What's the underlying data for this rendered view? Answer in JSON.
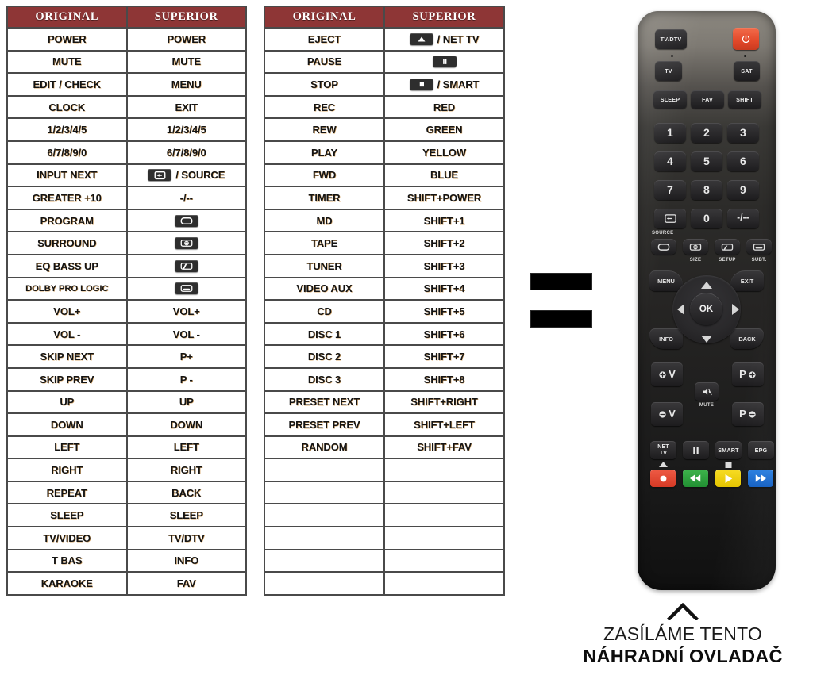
{
  "tables": [
    {
      "id": "table-left",
      "headers": [
        "ORIGINAL",
        "SUPERIOR"
      ],
      "rows": [
        {
          "original": "POWER",
          "superior": "POWER"
        },
        {
          "original": "MUTE",
          "superior": "MUTE"
        },
        {
          "original": "EDIT / CHECK",
          "superior": "MENU"
        },
        {
          "original": "CLOCK",
          "superior": "EXIT"
        },
        {
          "original": "1/2/3/4/5",
          "superior": "1/2/3/4/5"
        },
        {
          "original": "6/7/8/9/0",
          "superior": "6/7/8/9/0"
        },
        {
          "original": "INPUT NEXT",
          "superior": "/ SOURCE",
          "icon": "source-icon"
        },
        {
          "original": "GREATER +10",
          "superior": "-/--"
        },
        {
          "original": "PROGRAM",
          "superior": "",
          "icon": "aspect-ratio-icon"
        },
        {
          "original": "SURROUND",
          "superior": "",
          "icon": "size-icon"
        },
        {
          "original": "EQ BASS UP",
          "superior": "",
          "icon": "setup-icon"
        },
        {
          "original": "DOLBY PRO LOGIC",
          "superior": "",
          "icon": "subtitle-icon",
          "small": true
        },
        {
          "original": "VOL+",
          "superior": "VOL+"
        },
        {
          "original": "VOL -",
          "superior": "VOL -"
        },
        {
          "original": "SKIP NEXT",
          "superior": "P+"
        },
        {
          "original": "SKIP PREV",
          "superior": "P -"
        },
        {
          "original": "UP",
          "superior": "UP"
        },
        {
          "original": "DOWN",
          "superior": "DOWN"
        },
        {
          "original": "LEFT",
          "superior": "LEFT"
        },
        {
          "original": "RIGHT",
          "superior": "RIGHT"
        },
        {
          "original": "REPEAT",
          "superior": "BACK"
        },
        {
          "original": "SLEEP",
          "superior": "SLEEP"
        },
        {
          "original": "TV/VIDEO",
          "superior": "TV/DTV"
        },
        {
          "original": "T BAS",
          "superior": "INFO"
        },
        {
          "original": "KARAOKE",
          "superior": "FAV"
        }
      ]
    },
    {
      "id": "table-right",
      "headers": [
        "ORIGINAL",
        "SUPERIOR"
      ],
      "rows": [
        {
          "original": "EJECT",
          "superior": "/ NET TV",
          "icon": "eject-icon"
        },
        {
          "original": "PAUSE",
          "superior": "",
          "icon": "pause-icon"
        },
        {
          "original": "STOP",
          "superior": "/ SMART",
          "icon": "stop-icon"
        },
        {
          "original": "REC",
          "superior": "RED"
        },
        {
          "original": "REW",
          "superior": "GREEN"
        },
        {
          "original": "PLAY",
          "superior": "YELLOW"
        },
        {
          "original": "FWD",
          "superior": "BLUE"
        },
        {
          "original": "TIMER",
          "superior": "SHIFT+POWER"
        },
        {
          "original": "MD",
          "superior": "SHIFT+1"
        },
        {
          "original": "TAPE",
          "superior": "SHIFT+2"
        },
        {
          "original": "TUNER",
          "superior": "SHIFT+3"
        },
        {
          "original": "VIDEO AUX",
          "superior": "SHIFT+4"
        },
        {
          "original": "CD",
          "superior": "SHIFT+5"
        },
        {
          "original": "DISC 1",
          "superior": "SHIFT+6"
        },
        {
          "original": "DISC 2",
          "superior": "SHIFT+7"
        },
        {
          "original": "DISC 3",
          "superior": "SHIFT+8"
        },
        {
          "original": "PRESET NEXT",
          "superior": "SHIFT+RIGHT"
        },
        {
          "original": "PRESET PREV",
          "superior": "SHIFT+LEFT"
        },
        {
          "original": "RANDOM",
          "superior": "SHIFT+FAV"
        },
        {
          "original": "",
          "superior": ""
        },
        {
          "original": "",
          "superior": ""
        },
        {
          "original": "",
          "superior": ""
        },
        {
          "original": "",
          "superior": ""
        },
        {
          "original": "",
          "superior": ""
        },
        {
          "original": "",
          "superior": ""
        }
      ]
    }
  ],
  "equals_sign": {
    "name": "equals-symbol",
    "bars": 2
  },
  "remote": {
    "power_label": "",
    "buttons": {
      "tvdtv": "TV/DTV",
      "tv": "TV",
      "sat": "SAT",
      "sleep": "SLEEP",
      "fav": "FAV",
      "shift": "SHIFT",
      "n1": "1",
      "n2": "2",
      "n3": "3",
      "n4": "4",
      "n5": "5",
      "n6": "6",
      "n7": "7",
      "n8": "8",
      "n9": "9",
      "n0": "0",
      "dash": "-/--",
      "source_label": "SOURCE",
      "size_label": "SIZE",
      "setup_label": "SETUP",
      "subt_label": "SUBT.",
      "menu": "MENU",
      "exit": "EXIT",
      "ok": "OK",
      "info": "INFO",
      "back": "BACK",
      "vol_up": "V",
      "vol_down": "V",
      "prog_up": "P",
      "prog_down": "P",
      "mute_label": "MUTE",
      "nettv": "NET\nTV",
      "smart": "SMART",
      "epg": "EPG"
    },
    "colors": {
      "power": "#e2482a",
      "red": "#e2402c",
      "green": "#2fa03c",
      "yellow": "#f2d000",
      "blue": "#1a6fd4"
    }
  },
  "footer": {
    "line1": "ZASÍLÁME TENTO",
    "line2": "NÁHRADNÍ OVLADAČ",
    "chevron": "chevron-up-icon"
  }
}
